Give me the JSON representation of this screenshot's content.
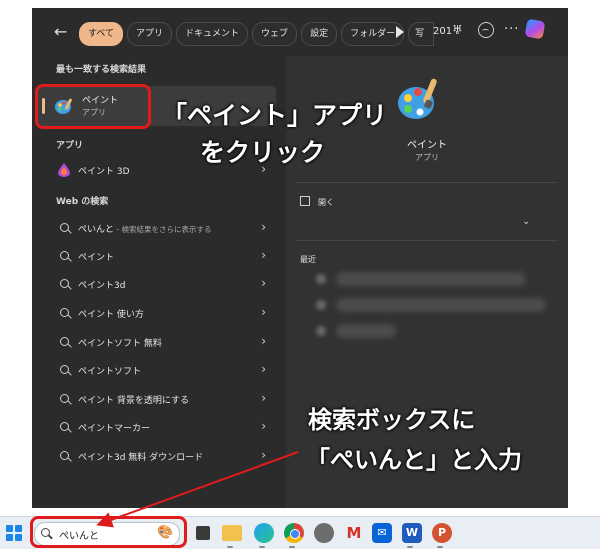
{
  "filters": {
    "back_label": "←",
    "chips": [
      "すべて",
      "アプリ",
      "ドキュメント",
      "ウェブ",
      "設定",
      "フォルダー",
      "写"
    ],
    "points": "201",
    "more_label": "···"
  },
  "left": {
    "best_match_heading": "最も一致する検索結果",
    "best_match": {
      "title": "ペイント",
      "subtitle": "アプリ"
    },
    "apps_heading": "アプリ",
    "apps": [
      {
        "label": "ペイント 3D"
      }
    ],
    "web_heading": "Web の検索",
    "web_results": [
      {
        "label": "ぺいんと",
        "hint": " - 検索結果をさらに表示する"
      },
      {
        "label": "ペイント",
        "hint": ""
      },
      {
        "label": "ペイント3d",
        "hint": ""
      },
      {
        "label": "ペイント 使い方",
        "hint": ""
      },
      {
        "label": "ペイントソフト 無料",
        "hint": ""
      },
      {
        "label": "ペイントソフト",
        "hint": ""
      },
      {
        "label": "ペイント 背景を透明にする",
        "hint": ""
      },
      {
        "label": "ペイントマーカー",
        "hint": ""
      },
      {
        "label": "ペイント3d 無料 ダウンロード",
        "hint": ""
      }
    ]
  },
  "right": {
    "title": "ペイント",
    "subtitle": "アプリ",
    "open_label": "開く",
    "recent_heading": "最近"
  },
  "taskbar": {
    "search_value": "ぺいんと"
  },
  "annotations": {
    "line1": "「ペイント」アプリ",
    "line2": "をクリック",
    "line3": "検索ボックスに",
    "line4": "「ぺいんと」と入力"
  },
  "colors": {
    "panel": "#2b2b2b",
    "accent": "#f0b78a",
    "highlight": "#e01b1b"
  }
}
